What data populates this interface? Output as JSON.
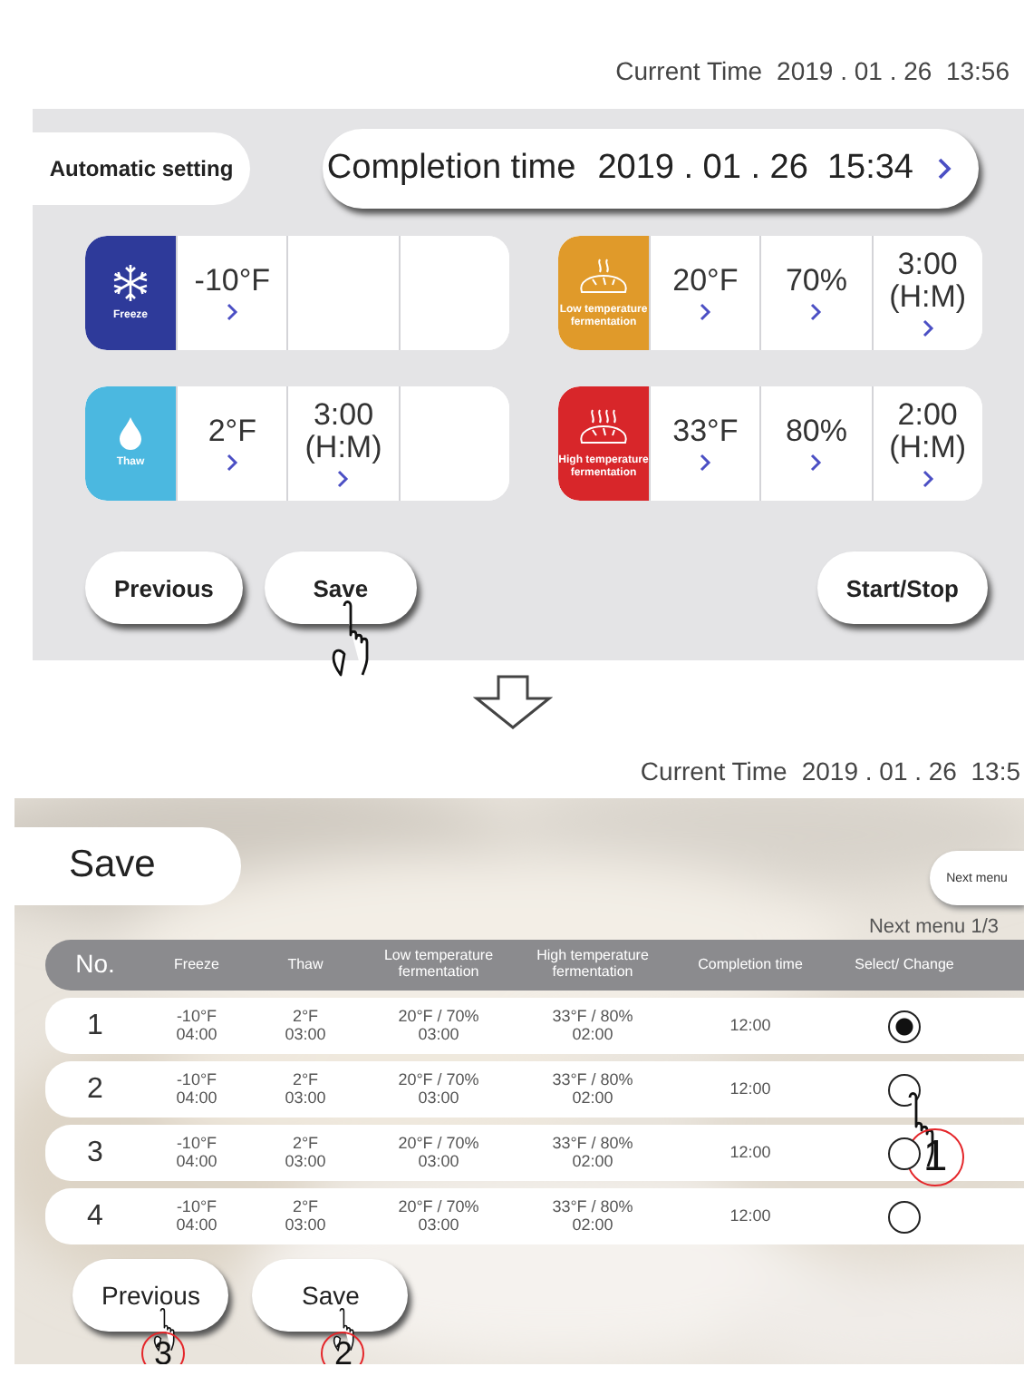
{
  "settings_screen": {
    "current_time": {
      "label": "Current Time",
      "value": "2019 . 01 . 26  13:56"
    },
    "mode_button": "Automatic setting",
    "completion_time": {
      "label": "Completion time",
      "value": "2019 . 01 . 26  15:34"
    },
    "program_rows": [
      {
        "programs": [
          {
            "kind": "freeze",
            "label": "Freeze",
            "color": "#2e3a9a",
            "cells": [
              {
                "kind": "value",
                "value": "-10°F"
              },
              {
                "kind": "empty"
              },
              {
                "kind": "empty"
              }
            ]
          },
          {
            "kind": "low_fermentation",
            "label": "Low temperature fermentation",
            "color": "#e09a2a",
            "cells": [
              {
                "kind": "value",
                "value": "20°F"
              },
              {
                "kind": "value",
                "value": "70%"
              },
              {
                "kind": "value",
                "value": "3:00\n(H:M)"
              }
            ]
          }
        ]
      },
      {
        "programs": [
          {
            "kind": "thaw",
            "label": "Thaw",
            "color": "#4bb8e0",
            "cells": [
              {
                "kind": "value",
                "value": "2°F"
              },
              {
                "kind": "value",
                "value": "3:00\n(H:M)"
              },
              {
                "kind": "empty"
              }
            ]
          },
          {
            "kind": "high_fermentation",
            "label": "High temperature fermentation",
            "color": "#d8262a",
            "cells": [
              {
                "kind": "value",
                "value": "33°F"
              },
              {
                "kind": "value",
                "value": "80%"
              },
              {
                "kind": "value",
                "value": "2:00\n(H:M)"
              }
            ]
          }
        ]
      }
    ],
    "buttons": [
      {
        "label": "Previous",
        "pointer": false
      },
      {
        "label": "Save",
        "pointer": true
      },
      {
        "label": "Start/Stop",
        "pointer": false
      }
    ]
  },
  "save_screen": {
    "current_time": {
      "label": "Current Time",
      "value": "2019 . 01 . 26  13:5"
    },
    "title": "Save",
    "next_button": "Next menu",
    "page_indicator": "Next menu 1/3",
    "table": {
      "columns": [
        "No.",
        "Freeze",
        "Thaw",
        "Low temperature\nfermentation",
        "High temperature\nfermentation",
        "Completion time",
        "Select/ Change"
      ],
      "rows": [
        {
          "cells": [
            "1",
            "-10°F\n04:00",
            "2°F\n03:00",
            "20°F / 70%\n03:00",
            "33°F / 80%\n02:00",
            "12:00"
          ],
          "selected": true
        },
        {
          "cells": [
            "2",
            "-10°F\n04:00",
            "2°F\n03:00",
            "20°F / 70%\n03:00",
            "33°F / 80%\n02:00",
            "12:00"
          ],
          "selected": false,
          "step": "1"
        },
        {
          "cells": [
            "3",
            "-10°F\n04:00",
            "2°F\n03:00",
            "20°F / 70%\n03:00",
            "33°F / 80%\n02:00",
            "12:00"
          ],
          "selected": false
        },
        {
          "cells": [
            "4",
            "-10°F\n04:00",
            "2°F\n03:00",
            "20°F / 70%\n03:00",
            "33°F / 80%\n02:00",
            "12:00"
          ],
          "selected": false
        }
      ]
    },
    "buttons": [
      {
        "label": "Previous",
        "step": "3"
      },
      {
        "label": "Save",
        "step": "2"
      }
    ]
  }
}
